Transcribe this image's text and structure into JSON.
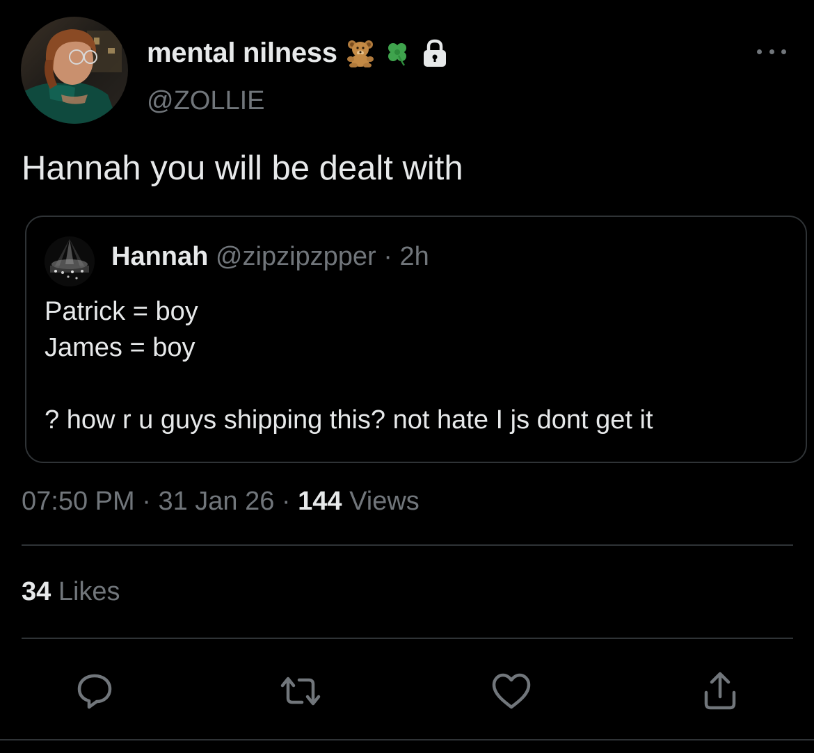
{
  "author": {
    "display_name": "mental nilness",
    "handle": "@ZOLLIE",
    "badges": [
      "teddy-bear-emoji",
      "four-leaf-clover-emoji",
      "lock-icon"
    ]
  },
  "tweet": {
    "text": "Hannah you will be dealt with",
    "time": "07:50 PM",
    "date": "31 Jan 26",
    "views_count": "144",
    "views_label": "Views",
    "likes_count": "34",
    "likes_label": "Likes"
  },
  "quoted_tweet": {
    "name": "Hannah",
    "handle": "@zipzipzpper",
    "age": "2h",
    "lines": [
      "Patrick = boy",
      "James = boy",
      "",
      "? how r u guys shipping this? not hate I js dont get it"
    ]
  },
  "separator": "·",
  "actions": [
    "reply-icon",
    "retweet-icon",
    "like-icon",
    "share-icon"
  ],
  "colors": {
    "background": "#000000",
    "text_primary": "#e7e9ea",
    "text_secondary": "#71767b",
    "border": "#2f3336"
  }
}
